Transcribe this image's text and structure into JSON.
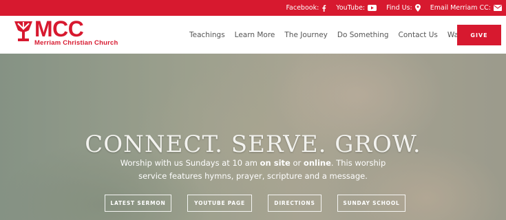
{
  "topbar": {
    "facebook_label": "Facebook:",
    "youtube_label": "YouTube:",
    "findus_label": "Find Us:",
    "email_label": "Email Merriam CC:"
  },
  "logo": {
    "abbr": "MCC",
    "name": "Merriam Christian Church"
  },
  "nav": {
    "items": [
      "Teachings",
      "Learn More",
      "The Journey",
      "Do Something",
      "Contact Us",
      "Ways To Give"
    ],
    "give_label": "GIVE"
  },
  "hero": {
    "headline": "CONNECT. SERVE. GROW.",
    "sub_part1": "Worship with us Sundays at 10 am ",
    "sub_onsite": "on site",
    "sub_or": " or ",
    "sub_online": "online",
    "sub_part2": ". This worship service features hymns, prayer,  scripture and a message.",
    "buttons": [
      "LATEST SERMON",
      "YOUTUBE PAGE",
      "DIRECTIONS",
      "SUNDAY SCHOOL"
    ]
  },
  "colors": {
    "brand_red": "#d7192f",
    "nav_text": "#555555"
  }
}
